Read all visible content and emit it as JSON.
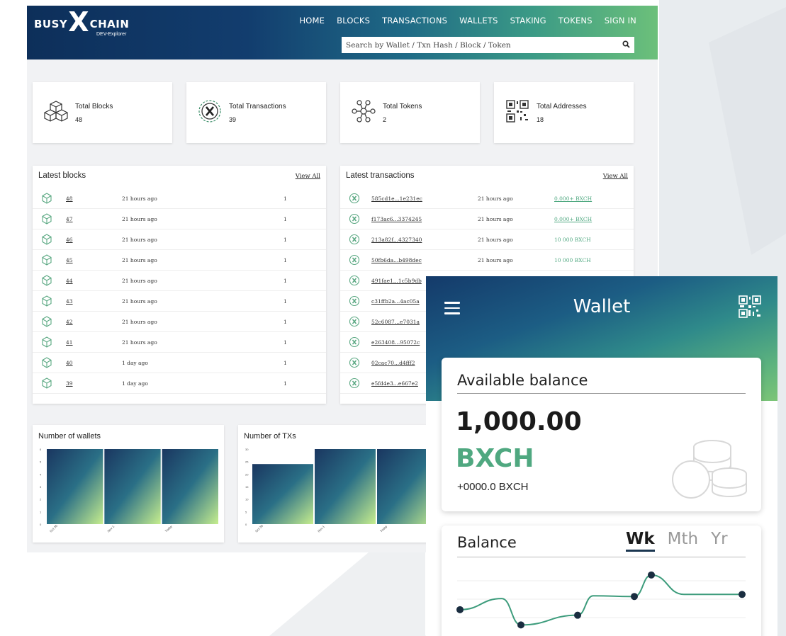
{
  "explorer": {
    "logo": {
      "word1": "BUSY",
      "mark": "X",
      "word2": "CHAIN",
      "sub": "DEV-Explorer"
    },
    "nav": [
      "HOME",
      "BLOCKS",
      "TRANSACTIONS",
      "WALLETS",
      "STAKING",
      "TOKENS",
      "SIGN IN"
    ],
    "search_placeholder": "Search by Wallet / Txn Hash / Block / Token",
    "stats": [
      {
        "label": "Total Blocks",
        "value": "48",
        "icon": "cubes-icon"
      },
      {
        "label": "Total Transactions",
        "value": "39",
        "icon": "x-coin-icon"
      },
      {
        "label": "Total Tokens",
        "value": "2",
        "icon": "network-icon"
      },
      {
        "label": "Total Addresses",
        "value": "18",
        "icon": "qr-icon"
      }
    ],
    "latest_blocks": {
      "title": "Latest blocks",
      "view_all": "View All",
      "rows": [
        {
          "block": "48",
          "age": "21 hours ago",
          "count": "1"
        },
        {
          "block": "47",
          "age": "21 hours ago",
          "count": "1"
        },
        {
          "block": "46",
          "age": "21 hours ago",
          "count": "1"
        },
        {
          "block": "45",
          "age": "21 hours ago",
          "count": "1"
        },
        {
          "block": "44",
          "age": "21 hours ago",
          "count": "1"
        },
        {
          "block": "43",
          "age": "21 hours ago",
          "count": "1"
        },
        {
          "block": "42",
          "age": "21 hours ago",
          "count": "1"
        },
        {
          "block": "41",
          "age": "21 hours ago",
          "count": "1"
        },
        {
          "block": "40",
          "age": "1 day ago",
          "count": "1"
        },
        {
          "block": "39",
          "age": "1 day ago",
          "count": "1"
        }
      ]
    },
    "latest_transactions": {
      "title": "Latest transactions",
      "view_all": "View All",
      "rows": [
        {
          "hash": "585cd1e...1e231ec",
          "age": "21 hours ago",
          "amount": "0.000+ BXCH"
        },
        {
          "hash": "f173ac6...3374245",
          "age": "21 hours ago",
          "amount": "0.000+ BXCH"
        },
        {
          "hash": "213a82f...4327340",
          "age": "21 hours ago",
          "amount": "10 000 BXCH"
        },
        {
          "hash": "50fb6da...b498dec",
          "age": "21 hours ago",
          "amount": "10 000 BXCH"
        },
        {
          "hash": "491fae1...1c5b9db",
          "age": "",
          "amount": ""
        },
        {
          "hash": "c31ffb2a...4ac05a",
          "age": "",
          "amount": ""
        },
        {
          "hash": "52c6087...e7031a",
          "age": "",
          "amount": ""
        },
        {
          "hash": "e263408...95072c",
          "age": "",
          "amount": ""
        },
        {
          "hash": "02cac70...d4fff2",
          "age": "",
          "amount": ""
        },
        {
          "hash": "e5fd4e3...e667e2",
          "age": "",
          "amount": ""
        }
      ]
    },
    "charts_titles": [
      "Number of wallets",
      "Number of TXs"
    ]
  },
  "chart_data": [
    {
      "type": "bar",
      "title": "Number of wallets",
      "categories": [
        "Oct 30",
        "Nov 1",
        "Today"
      ],
      "values": [
        6,
        6,
        6
      ],
      "ylim": [
        0,
        6
      ],
      "yticks": [
        "0",
        "1",
        "2",
        "3",
        "4",
        "5",
        "6"
      ]
    },
    {
      "type": "bar",
      "title": "Number of TXs",
      "categories": [
        "Oct 30",
        "Nov 1",
        "Today"
      ],
      "values": [
        24,
        30,
        30
      ],
      "ylim": [
        0,
        30
      ],
      "yticks": [
        "0",
        "5",
        "10",
        "15",
        "20",
        "25",
        "30"
      ]
    }
  ],
  "wallet": {
    "title": "Wallet",
    "balance_title": "Available balance",
    "amount": "1,000.00",
    "currency": "BXCH",
    "change": "+0000.0 BXCH",
    "graph_title": "Balance",
    "tabs": [
      "Wk",
      "Mth",
      "Yr"
    ],
    "active_tab": "Wk",
    "line_values": [
      0.42,
      0.58,
      0.2,
      0.34,
      0.62,
      0.61,
      0.92,
      0.64,
      0.64
    ]
  }
}
